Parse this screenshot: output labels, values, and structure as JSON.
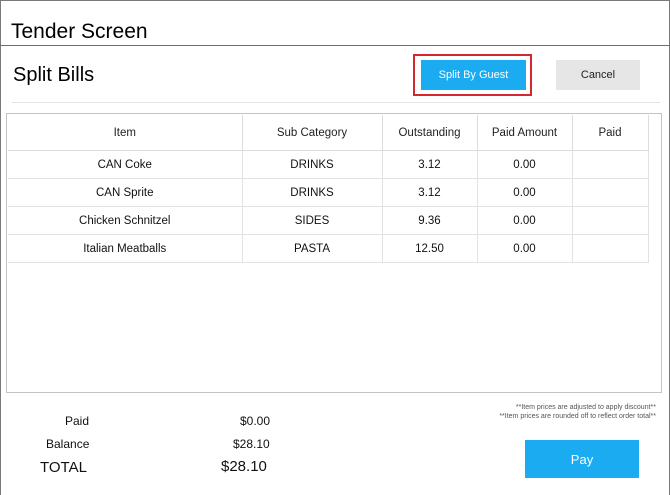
{
  "window": {
    "title": "Tender Screen"
  },
  "header": {
    "title": "Split Bills",
    "split_by_guest_label": "Split By Guest",
    "cancel_label": "Cancel"
  },
  "table": {
    "columns": [
      "Item",
      "Sub Category",
      "Outstanding",
      "Paid Amount",
      "Paid"
    ],
    "rows": [
      {
        "item": "CAN Coke",
        "sub_category": "DRINKS",
        "outstanding": "3.12",
        "paid_amount": "0.00",
        "paid": ""
      },
      {
        "item": "CAN Sprite",
        "sub_category": "DRINKS",
        "outstanding": "3.12",
        "paid_amount": "0.00",
        "paid": ""
      },
      {
        "item": "Chicken Schnitzel",
        "sub_category": "SIDES",
        "outstanding": "9.36",
        "paid_amount": "0.00",
        "paid": ""
      },
      {
        "item": "Italian Meatballs",
        "sub_category": "PASTA",
        "outstanding": "12.50",
        "paid_amount": "0.00",
        "paid": ""
      }
    ]
  },
  "summary": {
    "paid_label": "Paid",
    "paid_value": "$0.00",
    "balance_label": "Balance",
    "balance_value": "$28.10",
    "total_label": "TOTAL",
    "total_value": "$28.10"
  },
  "notes": {
    "line1": "**Item prices are adjusted to apply discount**",
    "line2": "**Item prices are rounded off to reflect order total**"
  },
  "actions": {
    "pay_label": "Pay"
  },
  "colors": {
    "accent": "#1aabf0",
    "highlight": "#d6262e",
    "cancel_bg": "#e6e6e6"
  }
}
